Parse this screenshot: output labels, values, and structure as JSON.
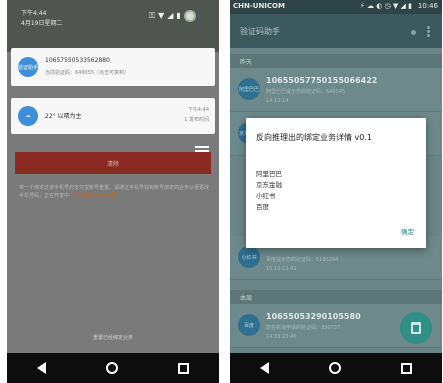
{
  "left_phone": {
    "shade": {
      "time": "下午4:44",
      "date": "4月19日星期二",
      "icons": [
        "key-icon",
        "wifi-icon",
        "signal-icon",
        "battery-icon",
        "avatar-icon"
      ]
    },
    "sms_notification": {
      "icon_label": "验证助手",
      "title": "10657550533562880",
      "subtitle": "当前验证码：649055（点击可复制）"
    },
    "weather_notification": {
      "title": "22° 以晴为主",
      "right_top": "下午4:44",
      "right_bottom": "1 发布时间"
    },
    "button_label": "清除",
    "help_text": "将一个绑定过该手机号的支付宝账号重置，请通过手机号找到账号绑定的业务以便更改手机号码，正在开发中",
    "help_link": "（了解如何开启查看）",
    "clear_text": "重置已经绑定业务"
  },
  "right_phone": {
    "status": {
      "carrier": "CHN-UNICOM",
      "icons": "⚡ ☁ ◐ ◷ ▼ ◢ ▮",
      "time": "10:46"
    },
    "toolbar_title": "验证码助手",
    "sections": {
      "yesterday": "昨天",
      "earlier": "本周"
    },
    "messages": [
      {
        "icon_label": "阿里巴巴",
        "number": "10655057750155066422",
        "text": "阿里巴巴提示您的验证码：649345",
        "time": "14:12:14"
      },
      {
        "icon_label": "京东金融",
        "number": "",
        "text": "",
        "time": ""
      },
      {
        "icon_label": "小红书",
        "number": "",
        "text": "百度提示您的验证码：5186294",
        "time": "15:10:13:41"
      },
      {
        "icon_label": "百度",
        "number": "10655053290105580",
        "text": "您在新浪申请的验证码：390737",
        "time": "14:33:23:40"
      }
    ],
    "dialog": {
      "title": "反向推理出的绑定业务详情 v0.1",
      "items": [
        "阿里巴巴",
        "京东金融",
        "小红书",
        "百度"
      ],
      "ok": "确定"
    }
  },
  "colors": {
    "accent_teal": "#2f8f86",
    "red_button": "#8b2a23",
    "toolbar": "#3c5a5e"
  }
}
